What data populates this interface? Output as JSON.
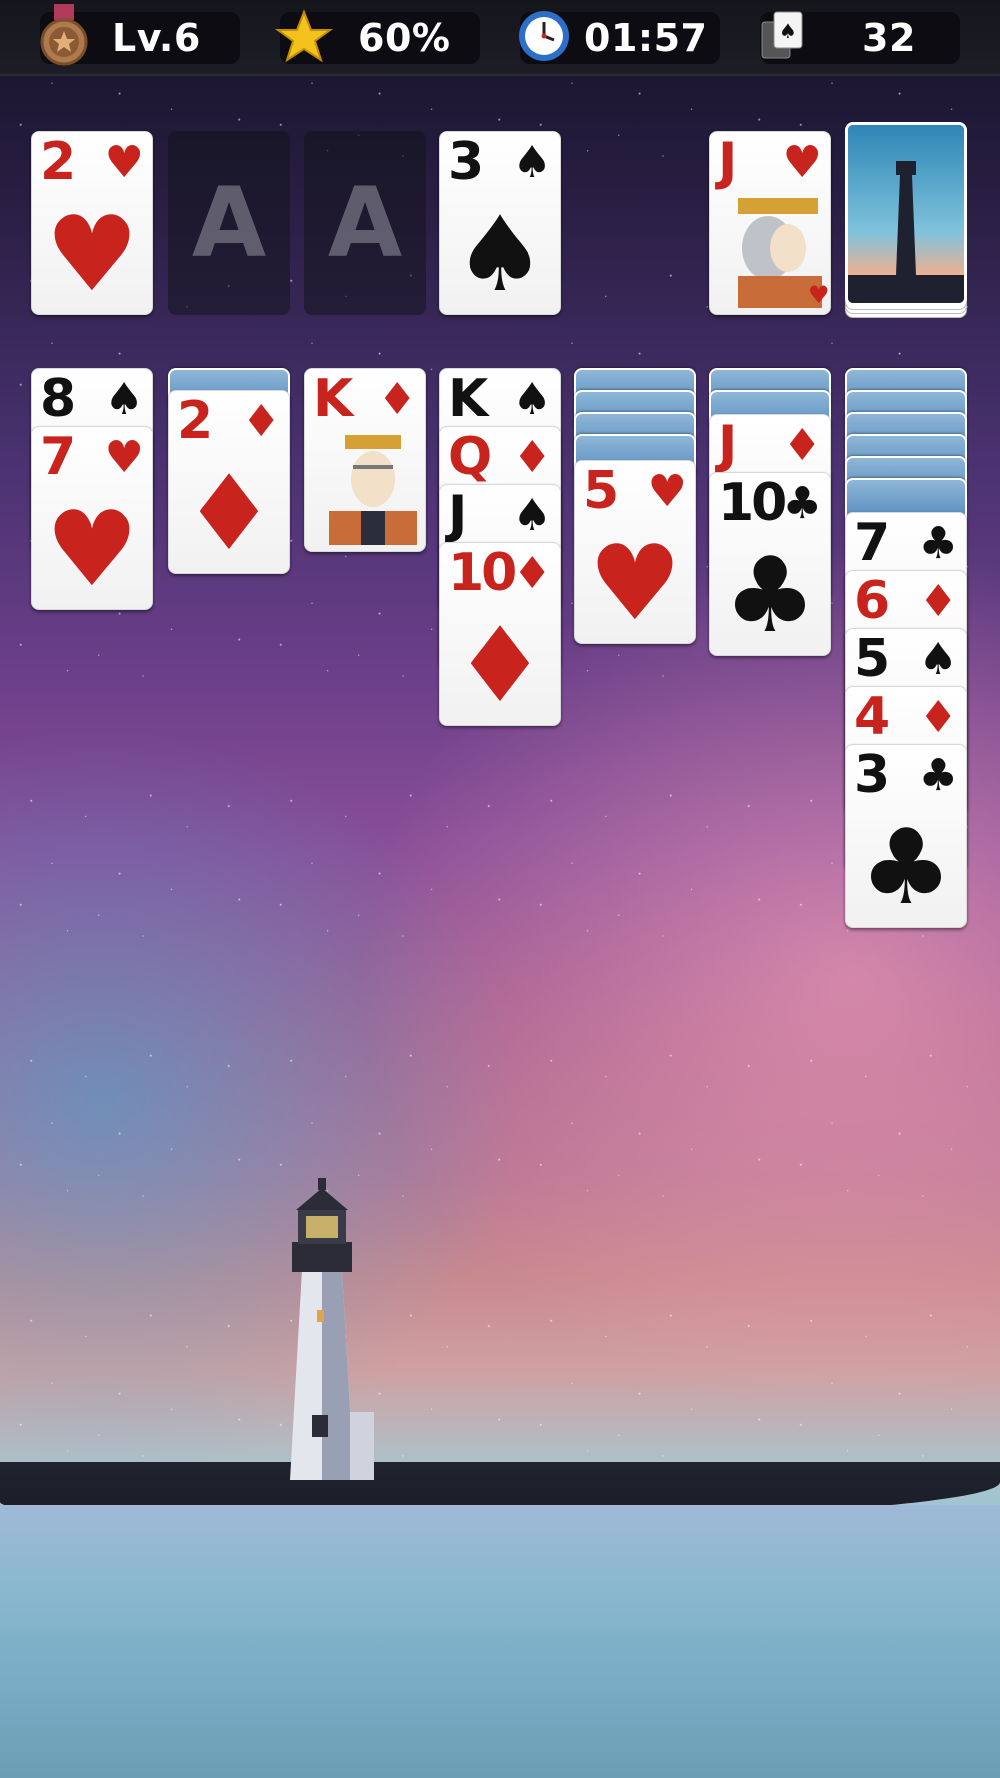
{
  "topbar": {
    "level": "Lv.6",
    "score": "60%",
    "time": "01:57",
    "moves": "32"
  },
  "foundation": {
    "slot_label": "A",
    "card1": {
      "rank": "2",
      "suit": "♥",
      "color": "red"
    },
    "card2": {
      "rank": "3",
      "suit": "♠",
      "color": "black"
    }
  },
  "waste": {
    "rank": "J",
    "suit": "♥",
    "color": "red"
  },
  "tableau": {
    "col1": [
      {
        "rank": "8",
        "suit": "♠"
      },
      {
        "rank": "7",
        "suit": "♥"
      }
    ],
    "col2": [
      {
        "rank": "2",
        "suit": "♦"
      }
    ],
    "col3": [
      {
        "rank": "K",
        "suit": "♦"
      }
    ],
    "col4": [
      {
        "rank": "K",
        "suit": "♠"
      },
      {
        "rank": "Q",
        "suit": "♦"
      },
      {
        "rank": "J",
        "suit": "♠"
      },
      {
        "rank": "10",
        "suit": "♦"
      }
    ],
    "col5": [
      {
        "rank": "5",
        "suit": "♥"
      }
    ],
    "col6": [
      {
        "rank": "J",
        "suit": "♦"
      },
      {
        "rank": "10",
        "suit": "♣"
      }
    ],
    "col7": [
      {
        "rank": "7",
        "suit": "♣"
      },
      {
        "rank": "6",
        "suit": "♦"
      },
      {
        "rank": "5",
        "suit": "♠"
      },
      {
        "rank": "4",
        "suit": "♦"
      },
      {
        "rank": "3",
        "suit": "♣"
      }
    ]
  },
  "colors": {
    "red_suit": "#c8231d",
    "black_suit": "#111111",
    "card_back": "#5b8fc0"
  },
  "icons": {
    "level": "medal-icon",
    "score": "star-icon",
    "time": "clock-icon",
    "moves": "card-stack-icon"
  }
}
